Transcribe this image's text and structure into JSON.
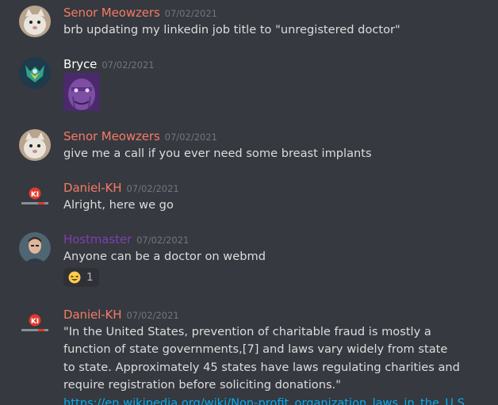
{
  "colors": {
    "background": "#36393f",
    "message_text": "#dcddde",
    "timestamp": "#72767d",
    "link": "#00aff4",
    "reaction_bg": "#2f3136"
  },
  "messages": [
    {
      "author": "Senor Meowzers",
      "author_color": "#f47b67",
      "timestamp": "07/02/2021",
      "avatar_icon": "cat-avatar-icon",
      "text": "brb updating my linkedin job title to \"unregistered doctor\""
    },
    {
      "author": "Bryce",
      "author_color": "#ffffff",
      "timestamp": "07/02/2021",
      "avatar_icon": "viking-helmet-avatar-icon",
      "attachment": "thanos-emoji-image"
    },
    {
      "author": "Senor Meowzers",
      "author_color": "#f47b67",
      "timestamp": "07/02/2021",
      "avatar_icon": "cat-avatar-icon",
      "text": "give me a call if you ever need some breast implants"
    },
    {
      "author": "Daniel-KH",
      "author_color": "#f47b67",
      "timestamp": "07/02/2021",
      "avatar_icon": "khan-logo-avatar-icon",
      "text": "Alright, here we go"
    },
    {
      "author": "Hostmaster",
      "author_color": "#7e3fb2",
      "timestamp": "07/02/2021",
      "avatar_icon": "man-portrait-avatar-icon",
      "text": "Anyone can be a doctor on webmd",
      "reaction": {
        "emoji_icon": "grinning-squinting-emoji-icon",
        "count": "1"
      }
    },
    {
      "author": "Daniel-KH",
      "author_color": "#f47b67",
      "timestamp": "07/02/2021",
      "avatar_icon": "khan-logo-avatar-icon",
      "text": "\"In the United States, prevention of charitable fraud is mostly a function of state governments,[7] and laws vary widely from state to state. Approximately 45 states have laws regulating charities and require registration before soliciting donations.\"",
      "link": "https://en.wikipedia.org/wiki/Non-profit_organization_laws_in_the_U.S."
    }
  ]
}
